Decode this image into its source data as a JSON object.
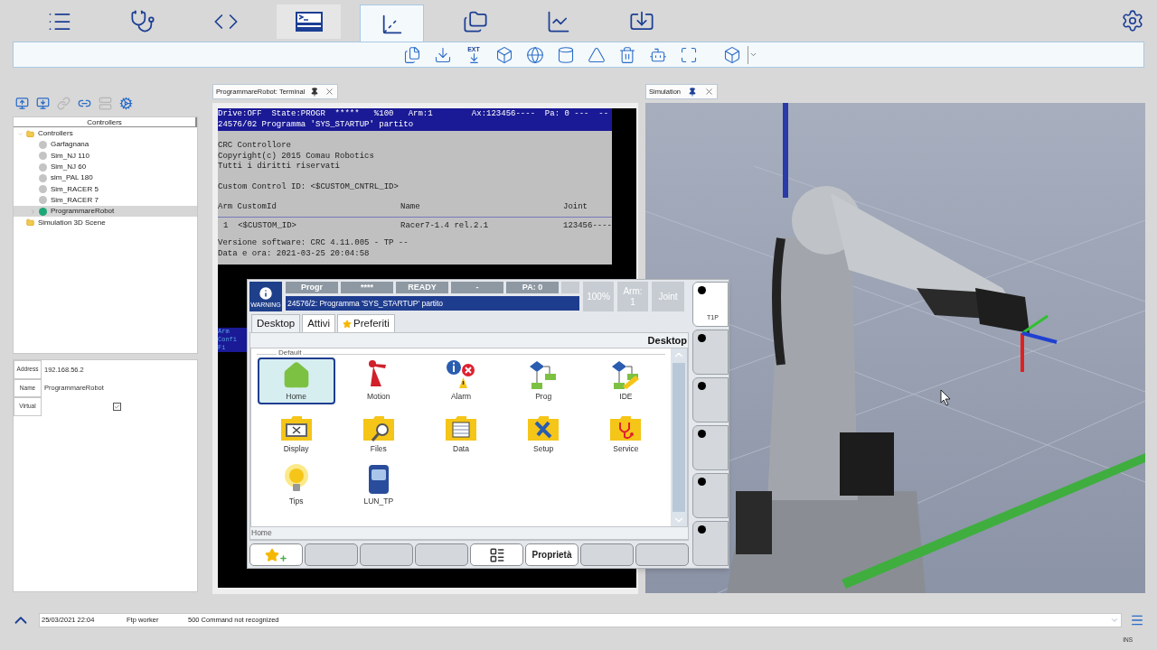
{
  "top_nav": {
    "items": [
      {
        "kind": "list",
        "selected": false,
        "highlighted": false
      },
      {
        "kind": "diagnostics",
        "selected": false,
        "highlighted": false
      },
      {
        "kind": "code",
        "selected": false,
        "highlighted": false
      },
      {
        "kind": "terminal",
        "selected": false,
        "highlighted": true
      },
      {
        "kind": "scene3d",
        "selected": true,
        "highlighted": false
      },
      {
        "kind": "folders",
        "selected": false,
        "highlighted": false
      },
      {
        "kind": "chart",
        "selected": false,
        "highlighted": false
      },
      {
        "kind": "export",
        "selected": false,
        "highlighted": false
      }
    ]
  },
  "toolbar": {
    "items": [
      {
        "kind": "copy"
      },
      {
        "kind": "download"
      },
      {
        "kind": "ext_download",
        "label": "EXT"
      },
      {
        "kind": "box"
      },
      {
        "kind": "sphere"
      },
      {
        "kind": "cylinder"
      },
      {
        "kind": "cone"
      },
      {
        "kind": "trash"
      },
      {
        "kind": "robot"
      },
      {
        "kind": "fit"
      },
      {
        "kind": "gap"
      },
      {
        "kind": "wire_box"
      },
      {
        "kind": "caret"
      }
    ]
  },
  "controllers_panel": {
    "toolbar": [
      {
        "kind": "add_controller",
        "disabled": false
      },
      {
        "kind": "import_controller",
        "disabled": false
      },
      {
        "kind": "link",
        "disabled": true
      },
      {
        "kind": "unlink",
        "disabled": false
      },
      {
        "kind": "storage",
        "disabled": true
      },
      {
        "kind": "settings",
        "disabled": false
      }
    ],
    "tree": {
      "header": "Controllers",
      "items": [
        {
          "label": "Controllers",
          "kind": "folder",
          "expanded": true,
          "children": [
            {
              "label": "Garfagnana",
              "kind": "controller",
              "color": "#c4c4c4",
              "selected": false
            },
            {
              "label": "Sim_NJ 110",
              "kind": "controller",
              "color": "#c4c4c4",
              "selected": false
            },
            {
              "label": "Sim_NJ 60",
              "kind": "controller",
              "color": "#c4c4c4",
              "selected": false
            },
            {
              "label": "sim_PAL 180",
              "kind": "controller",
              "color": "#c4c4c4",
              "selected": false
            },
            {
              "label": "Sim_RACER 5",
              "kind": "controller",
              "color": "#c4c4c4",
              "selected": false
            },
            {
              "label": "Sim_RACER 7",
              "kind": "controller",
              "color": "#c4c4c4",
              "selected": false
            },
            {
              "label": "ProgrammareRobot",
              "kind": "controller",
              "color": "#1ea776",
              "selected": true,
              "expanded": false
            }
          ]
        },
        {
          "label": "Simulation 3D Scene",
          "kind": "folder"
        }
      ]
    },
    "properties": [
      {
        "label": "Address",
        "kind": "text",
        "value": "192.168.56.2"
      },
      {
        "label": "Name",
        "kind": "text",
        "value": "ProgrammareRobot"
      },
      {
        "label": "Virtual",
        "kind": "checkbox",
        "checked": true
      }
    ]
  },
  "terminal": {
    "tab": "ProgrammareRobot: Terminal",
    "header": [
      "Drive:OFF  State:PROGR  *****   %100   Arm:1        Ax:123456----  Pa: 0 ---  --",
      "24576/02 Programma 'SYS_STARTUP' partito"
    ],
    "intro": [
      "CRC Controllore",
      "Copyright(c) 2015 Comau Robotics",
      "Tutti i diritti riservati"
    ],
    "control_id": "Custom Control ID: <$CUSTOM_CNTRL_ID>",
    "table_columns": [
      "Arm CustomId",
      "Name",
      "Joint"
    ],
    "table_row": [
      "1  <$CUSTOM_ID>",
      "Racer7-1.4 rel.2.1",
      "123456----"
    ],
    "footer": [
      "Versione software: CRC 4.11.005 - TP --",
      "Data e ora: 2021-03-25 20:04:58"
    ],
    "hidden_fragments": [
      "Arm",
      "Confi",
      "Fi"
    ]
  },
  "pendant": {
    "warning": "WARNING",
    "status_cells": [
      "Progr",
      "****",
      "READY",
      "-",
      "PA: 0"
    ],
    "message": "24576/2: Programma 'SYS_STARTUP' partito",
    "readouts": [
      {
        "lines": [
          "100%"
        ]
      },
      {
        "lines": [
          "Arm:",
          "1"
        ]
      },
      {
        "lines": [
          "Joint"
        ]
      }
    ],
    "tabs": [
      {
        "label": "Desktop",
        "kind": "plain",
        "selected": true
      },
      {
        "label": "Attivi",
        "kind": "plain",
        "selected": false
      },
      {
        "label": "Preferiti",
        "kind": "favorites",
        "selected": false
      }
    ],
    "heading": "Desktop",
    "group": "Default",
    "apps": [
      {
        "label": "Home",
        "kind": "home",
        "selected": true
      },
      {
        "label": "Motion",
        "kind": "motion",
        "selected": false
      },
      {
        "label": "Alarm",
        "kind": "alarm",
        "selected": false
      },
      {
        "label": "Prog",
        "kind": "prog",
        "selected": false
      },
      {
        "label": "IDE",
        "kind": "ide",
        "selected": false
      },
      {
        "label": "Display",
        "kind": "display",
        "selected": false
      },
      {
        "label": "Files",
        "kind": "files",
        "selected": false
      },
      {
        "label": "Data",
        "kind": "data",
        "selected": false
      },
      {
        "label": "Setup",
        "kind": "setup",
        "selected": false
      },
      {
        "label": "Service",
        "kind": "service",
        "selected": false
      },
      {
        "label": "Tips",
        "kind": "tips",
        "selected": false
      },
      {
        "label": "LUN_TP",
        "kind": "lun_tp",
        "selected": false
      }
    ],
    "path": "Home",
    "softkeys": [
      {
        "kind": "favorite_add"
      },
      {
        "kind": "empty"
      },
      {
        "kind": "empty"
      },
      {
        "kind": "empty"
      },
      {
        "kind": "layout"
      },
      {
        "kind": "text",
        "label": "Proprietà"
      },
      {
        "kind": "empty"
      },
      {
        "kind": "empty"
      }
    ],
    "side_keys": [
      {
        "label": "T1P",
        "active": true
      },
      {
        "active": false
      },
      {
        "active": false
      },
      {
        "active": false
      },
      {
        "active": false
      },
      {
        "active": false
      }
    ]
  },
  "simulation": {
    "tab": "Simulation"
  },
  "status_bar": {
    "time": "25/03/2021 22:04",
    "source": "Ftp worker",
    "message": "500 Command not recognized",
    "mode": "INS"
  }
}
